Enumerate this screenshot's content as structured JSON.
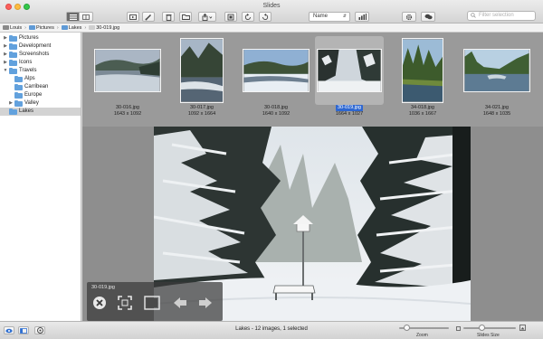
{
  "window": {
    "title": "Slides"
  },
  "toolbar": {
    "sort_value": "Name",
    "search_placeholder": "Filter selection"
  },
  "pathbar": {
    "items": [
      "Louis",
      "Pictures",
      "Lakes",
      "30-019.jpg"
    ]
  },
  "sidebar": {
    "items": [
      {
        "label": "Pictures",
        "level": 0,
        "disclosure": "collapsed"
      },
      {
        "label": "Development",
        "level": 0,
        "disclosure": "collapsed"
      },
      {
        "label": "Screenshots",
        "level": 0,
        "disclosure": "collapsed"
      },
      {
        "label": "Icons",
        "level": 0,
        "disclosure": "collapsed"
      },
      {
        "label": "Travels",
        "level": 0,
        "disclosure": "expanded"
      },
      {
        "label": "Alps",
        "level": 1,
        "disclosure": "none"
      },
      {
        "label": "Carribean",
        "level": 1,
        "disclosure": "none"
      },
      {
        "label": "Europe",
        "level": 1,
        "disclosure": "none"
      },
      {
        "label": "Valley",
        "level": 1,
        "disclosure": "collapsed"
      },
      {
        "label": "Lakes",
        "level": 0,
        "disclosure": "none",
        "selected": true
      }
    ]
  },
  "thumbnails": [
    {
      "name": "30-016.jpg",
      "size": "1643 x 1092",
      "selected": false
    },
    {
      "name": "30-017.jpg",
      "size": "1092 x 1664",
      "selected": false
    },
    {
      "name": "30-018.jpg",
      "size": "1640 x 1092",
      "selected": false
    },
    {
      "name": "30-019.jpg",
      "size": "1664 x 1027",
      "selected": true
    },
    {
      "name": "34-018.jpg",
      "size": "1036 x 1667",
      "selected": false
    },
    {
      "name": "34-021.jpg",
      "size": "1648 x 1035",
      "selected": false
    }
  ],
  "viewer": {
    "current_name": "30-019.jpg"
  },
  "statusbar": {
    "text": "Lakes - 12 images, 1 selected",
    "zoom_label": "Zoom",
    "slides_size_label": "Slides Size",
    "zoom_value": 0.15,
    "slides_size_value": 0.35
  },
  "colors": {
    "selection": "#2e67d1",
    "folder": "#62a1dd",
    "viewer_bg": "#8e8e8e"
  }
}
